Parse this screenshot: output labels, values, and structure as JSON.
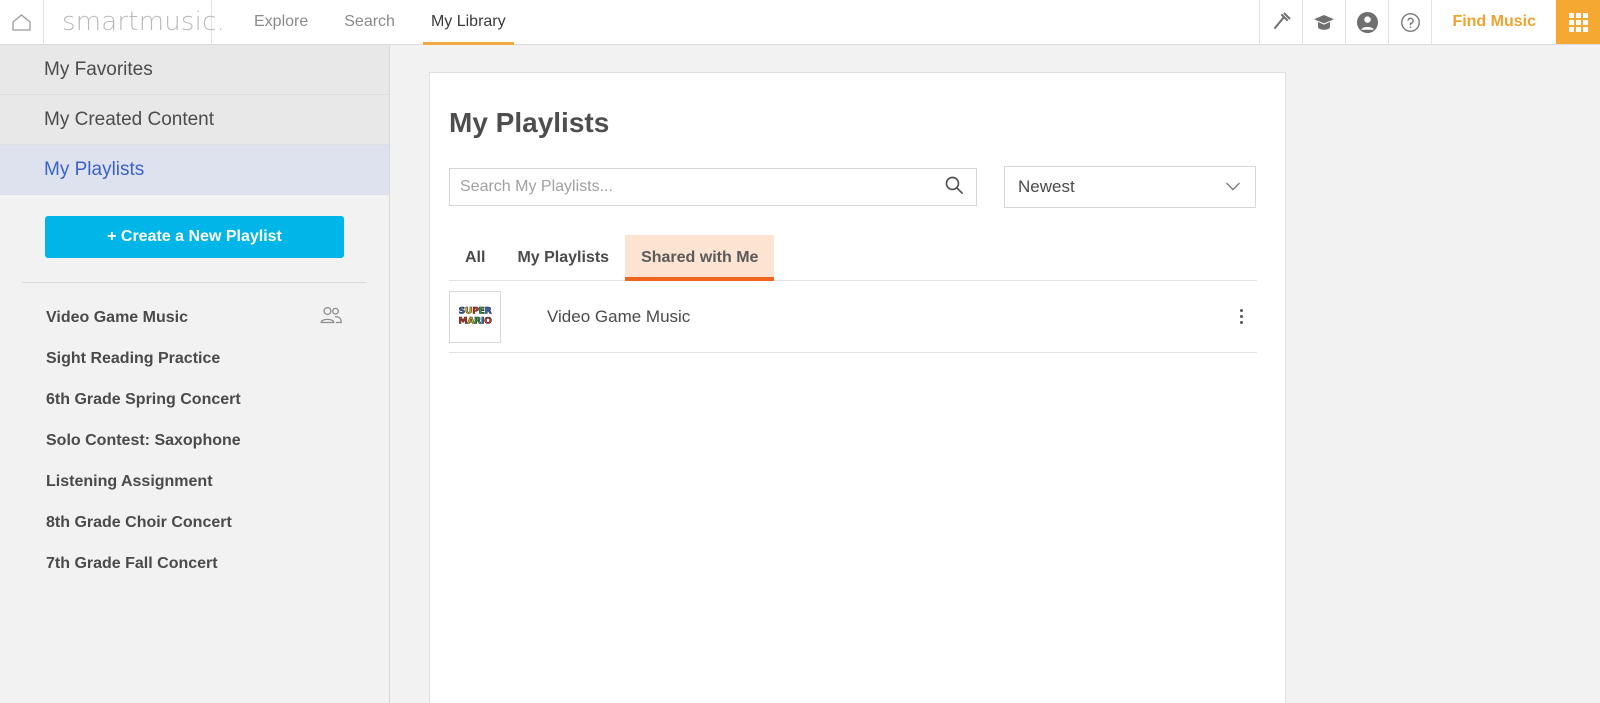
{
  "topnav": {
    "home_icon": "home-icon",
    "logo": "smartmusic.",
    "links": [
      {
        "label": "Explore",
        "active": false
      },
      {
        "label": "Search",
        "active": false
      },
      {
        "label": "My Library",
        "active": true
      }
    ],
    "icons": [
      {
        "name": "tuning-fork-icon"
      },
      {
        "name": "graduation-cap-icon"
      },
      {
        "name": "account-circle-icon"
      },
      {
        "name": "help-circle-icon"
      }
    ],
    "find_music_label": "Find Music",
    "grid_button": "app-grid-icon",
    "accent_orange": "#f5a832",
    "find_music_color": "#f0a22e"
  },
  "sidebar": {
    "sections": [
      {
        "label": "My Favorites",
        "selected": false
      },
      {
        "label": "My Created Content",
        "selected": false
      },
      {
        "label": "My Playlists",
        "selected": true
      }
    ],
    "create_button_label": "+ Create a New Playlist",
    "create_button_color": "#00b5e8",
    "playlists": [
      {
        "label": "Video Game Music",
        "shared": true
      },
      {
        "label": "Sight Reading Practice",
        "shared": false
      },
      {
        "label": "6th Grade Spring Concert",
        "shared": false
      },
      {
        "label": "Solo Contest: Saxophone",
        "shared": false
      },
      {
        "label": "Listening Assignment",
        "shared": false
      },
      {
        "label": "8th Grade Choir Concert",
        "shared": false
      },
      {
        "label": "7th Grade Fall Concert",
        "shared": false
      }
    ],
    "shared_icon": "people-group-icon"
  },
  "main": {
    "title": "My Playlists",
    "search": {
      "placeholder": "Search My Playlists...",
      "value": "",
      "icon": "search-icon"
    },
    "sort": {
      "selected": "Newest",
      "icon": "chevron-down-icon"
    },
    "tabs": [
      {
        "label": "All",
        "active": false
      },
      {
        "label": "My Playlists",
        "active": false
      },
      {
        "label": "Shared with Me",
        "active": true
      }
    ],
    "tab_active_bg": "#fce3d2",
    "tab_active_underline": "#f0641e",
    "rows": [
      {
        "title": "Video Game Music",
        "thumbnail": "super-mario-logo",
        "thumb_line1": "SUPER",
        "thumb_line2": "MARIO",
        "menu_icon": "kebab-menu-icon"
      }
    ]
  }
}
